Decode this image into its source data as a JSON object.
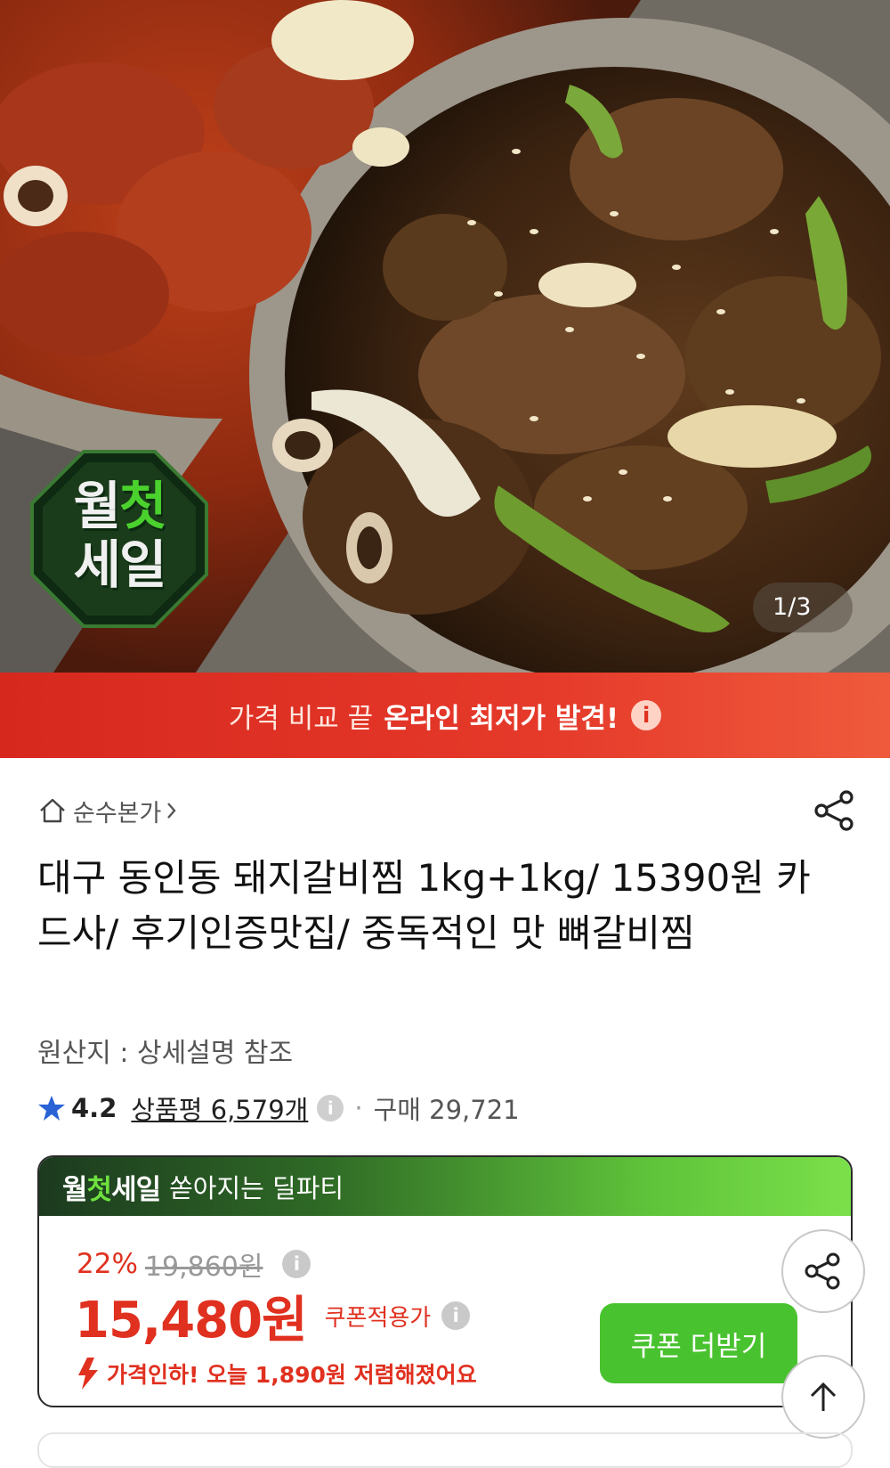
{
  "hero": {
    "badge_line1_a": "월",
    "badge_line1_b": "첫",
    "badge_line2": "세일",
    "counter": "1/3"
  },
  "banner": {
    "normal_text": "가격 비교 끝",
    "strong_text": "온라인 최저가 발견!",
    "info_icon": "info-icon"
  },
  "product": {
    "store_name": "순수본가",
    "title": "대구 동인동 돼지갈비찜 1kg+1kg/ 15390원 카드사/ 후기인증맛집/ 중독적인 맛 뼈갈비찜",
    "origin": "원산지 : 상세설명 참조",
    "rating": "4.2",
    "reviews": "상품평 6,579개",
    "purchases": "구매 29,721"
  },
  "deal": {
    "logo_a": "월",
    "logo_b": "첫",
    "logo_c": "세일",
    "tagline": "쏟아지는 딜파티",
    "discount_pct": "22%",
    "original_price": "19,860원",
    "price": "15,480원",
    "coupon_applied": "쿠폰적용가",
    "price_drop": "가격인하! 오늘 1,890원 저렴해졌어요",
    "coupon_button": "쿠폰 더받기"
  },
  "colors": {
    "accent_red": "#e0301f",
    "deal_green": "#49c22f"
  }
}
